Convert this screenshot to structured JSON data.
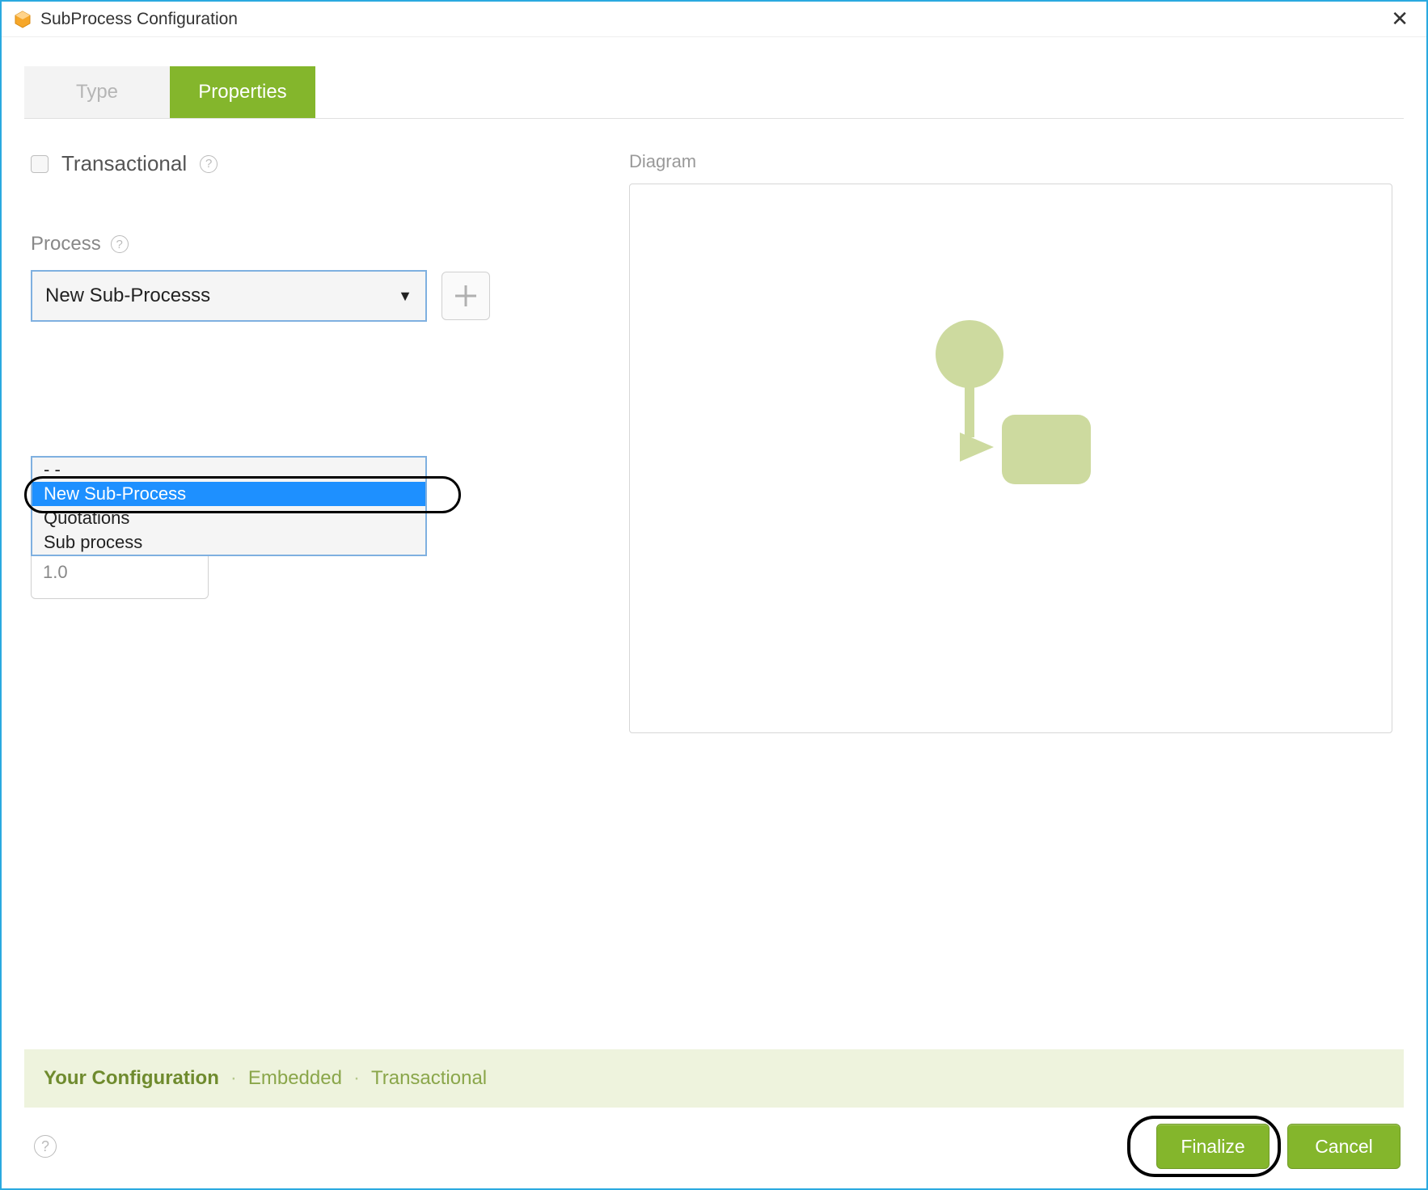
{
  "window": {
    "title": "SubProcess Configuration",
    "close_glyph": "✕"
  },
  "tabs": {
    "type": "Type",
    "properties": "Properties"
  },
  "form": {
    "transactional_label": "Transactional",
    "process_label": "Process",
    "help_glyph": "?",
    "select": {
      "selected": "New Sub-Processs",
      "options": [
        "- -",
        "New Sub-Process",
        "Quotations",
        "Sub process"
      ],
      "highlighted_index": 1
    },
    "version_partial": "1.0"
  },
  "diagram": {
    "label": "Diagram"
  },
  "summary": {
    "lead": "Your Configuration",
    "sep": "·",
    "val1": "Embedded",
    "val2": "Transactional"
  },
  "buttons": {
    "finalize": "Finalize",
    "cancel": "Cancel"
  }
}
